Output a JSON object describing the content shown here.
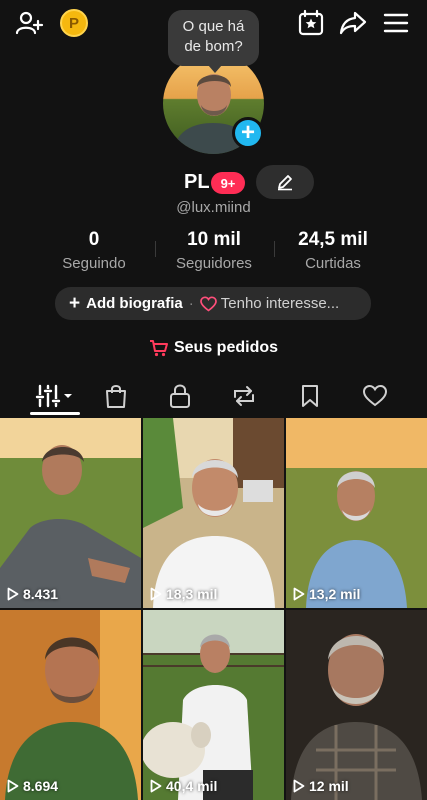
{
  "bubble": {
    "text_line1": "O que há",
    "text_line2": "de bom?"
  },
  "profile": {
    "name": "PL",
    "notif_badge": "9+",
    "handle": "@lux.miind"
  },
  "stats": [
    {
      "value": "0",
      "label": "Seguindo"
    },
    {
      "value": "10 mil",
      "label": "Seguidores"
    },
    {
      "value": "24,5 mil",
      "label": "Curtidas"
    }
  ],
  "bio": {
    "add_label": "Add biografia",
    "separator": "·",
    "interests_label": "Tenho interesse..."
  },
  "orders": {
    "label": "Seus pedidos"
  },
  "tabs": [
    "videos",
    "shop",
    "private",
    "reposts",
    "favorites",
    "liked"
  ],
  "videos": [
    {
      "views": "8.431"
    },
    {
      "views": "18,3 mil"
    },
    {
      "views": "13,2 mil"
    },
    {
      "views": "8.694"
    },
    {
      "views": "40,4 mil"
    },
    {
      "views": "12 mil"
    }
  ],
  "colors": {
    "accent": "#ff2d55",
    "plus_badge": "#21b8f0",
    "coin": "#f5b80f"
  }
}
